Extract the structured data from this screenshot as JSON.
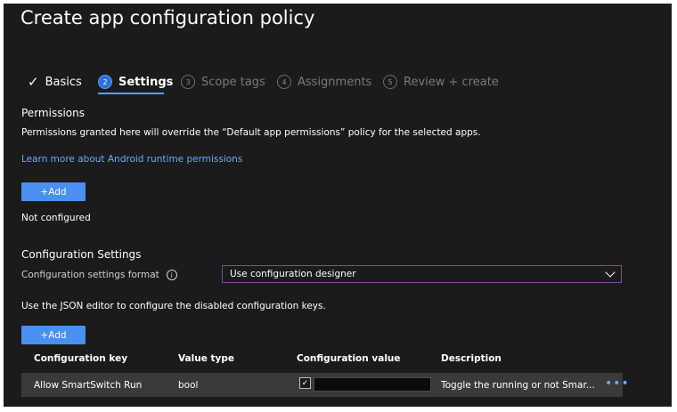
{
  "page_title": "Create app configuration policy",
  "wizard": {
    "steps": [
      {
        "label": "Basics",
        "state": "done",
        "icon": "check-icon"
      },
      {
        "label": "Settings",
        "number": "2",
        "state": "active"
      },
      {
        "label": "Scope tags",
        "number": "3",
        "state": "disabled"
      },
      {
        "label": "Assignments",
        "number": "4",
        "state": "disabled"
      },
      {
        "label": "Review + create",
        "number": "5",
        "state": "disabled"
      }
    ]
  },
  "permissions": {
    "heading": "Permissions",
    "description": "Permissions granted here will override the “Default app permissions” policy for the selected apps.",
    "learn_more": "Learn more about Android runtime permissions",
    "add_label": "+Add",
    "status": "Not configured"
  },
  "configuration": {
    "heading": "Configuration Settings",
    "format_label": "Configuration settings format",
    "format_value": "Use configuration designer",
    "json_note": "Use the JSON editor to configure the disabled configuration keys.",
    "add_label": "+Add",
    "table": {
      "headers": [
        "Configuration key",
        "Value type",
        "Configuration value",
        "Description"
      ],
      "rows": [
        {
          "key": "Allow SmartSwitch Run",
          "type": "bool",
          "checked": true,
          "description": "Toggle the running or not Smar..."
        }
      ]
    }
  },
  "colors": {
    "background": "#1b1b1b",
    "accent": "#4a90f0",
    "link": "#6aa9ff"
  }
}
